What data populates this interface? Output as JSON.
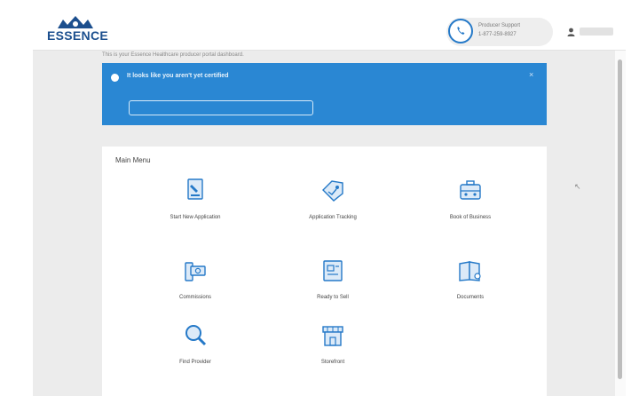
{
  "header": {
    "logo_text": "ESSENCE",
    "support_label": "Producer Support",
    "support_number": "1-877-259-8927",
    "user_name": ""
  },
  "intro": "This is your Essence Healthcare producer portal dashboard.",
  "banner": {
    "title": "It looks like you aren't yet certified",
    "subtitle": "",
    "button_label": "",
    "close_glyph": "×",
    "color": "#2a87d3"
  },
  "menu": {
    "title": "Main Menu",
    "items": [
      {
        "label": "Start New Application",
        "icon": "document-pen-icon"
      },
      {
        "label": "Application Tracking",
        "icon": "tag-tracking-icon"
      },
      {
        "label": "Book of Business",
        "icon": "briefcase-icon"
      },
      {
        "label": "Commissions",
        "icon": "money-icon"
      },
      {
        "label": "Ready to Sell",
        "icon": "certificate-icon"
      },
      {
        "label": "Documents",
        "icon": "book-icon"
      },
      {
        "label": "Find Provider",
        "icon": "magnifier-icon"
      },
      {
        "label": "Storefront",
        "icon": "storefront-icon"
      }
    ]
  },
  "colors": {
    "accent": "#2579c8",
    "brand": "#1c4f8e"
  }
}
